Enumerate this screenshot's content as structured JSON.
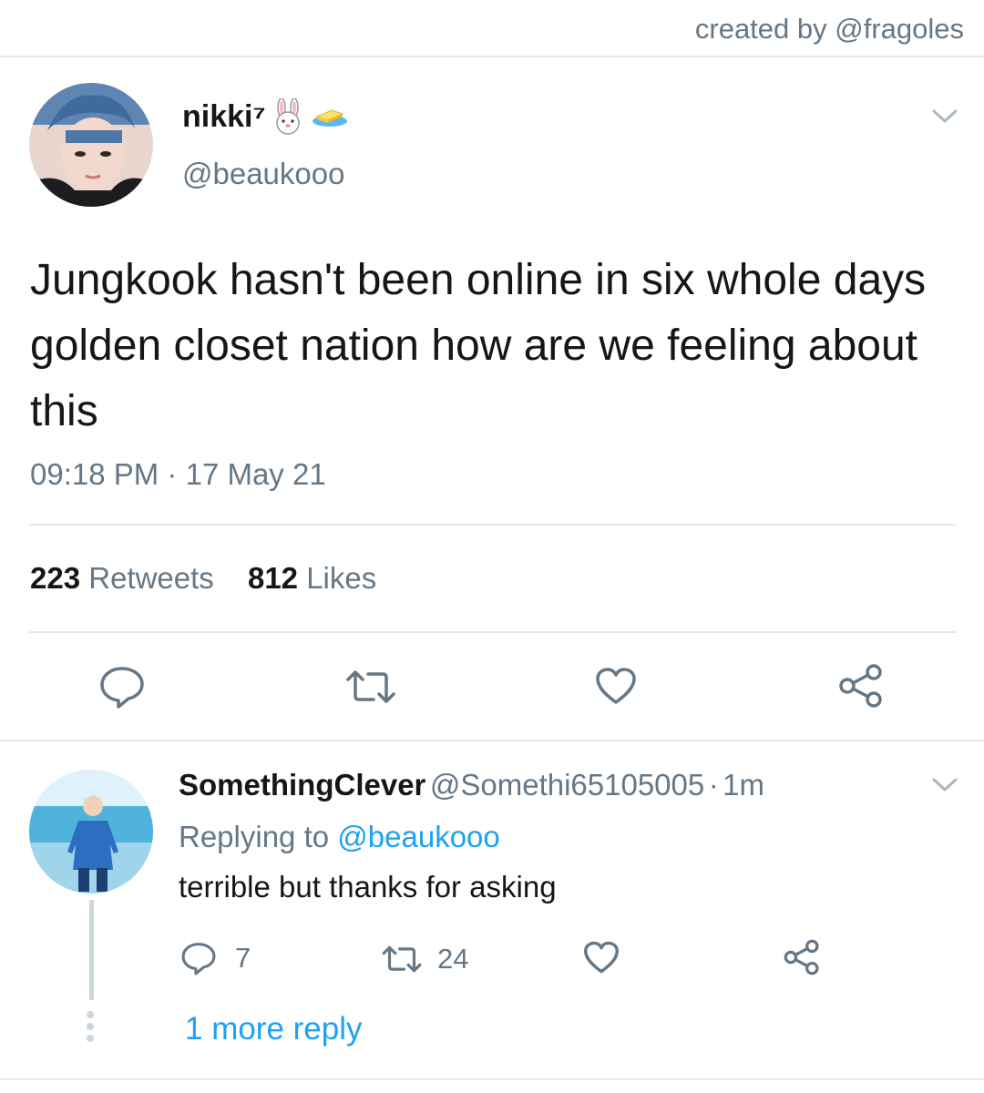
{
  "credit": "created by @fragoles",
  "tweet": {
    "display_name": "nikki⁷",
    "handle": "@beaukooo",
    "text": "Jungkook hasn't been online in six whole days golden closet nation how are we feeling about this",
    "time": "09:18 PM",
    "separator": "·",
    "date": "17 May 21",
    "retweets_count": "223",
    "retweets_label": "Retweets",
    "likes_count": "812",
    "likes_label": "Likes"
  },
  "reply": {
    "display_name": "SomethingClever",
    "handle": "@Somethi65105005",
    "separator": "·",
    "age": "1m",
    "replying_to_prefix": "Replying to",
    "replying_to_handle": "@beaukooo",
    "text": "terrible but thanks for asking",
    "reply_count": "7",
    "retweet_count": "24",
    "more_replies": "1 more reply"
  },
  "icons": {
    "emoji_1": "rabbit-face-icon",
    "emoji_2": "butter-icon",
    "menu": "chevron-down-icon",
    "reply": "reply-icon",
    "retweet": "retweet-icon",
    "like": "heart-icon",
    "share": "share-icon"
  },
  "colors": {
    "text": "#14171a",
    "muted": "#657786",
    "accent": "#1da1f2",
    "divider": "#e1e8ed"
  }
}
